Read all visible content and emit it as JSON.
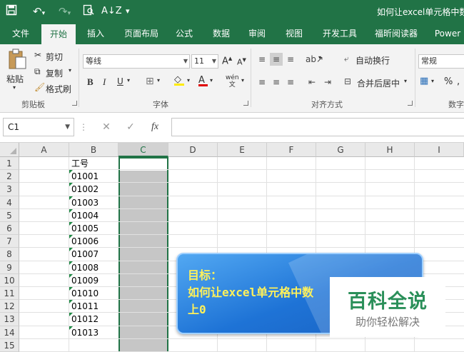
{
  "titlebar": {
    "doc_title": "如何让excel单元格中数字"
  },
  "tabs": [
    {
      "label": "文件"
    },
    {
      "label": "开始"
    },
    {
      "label": "插入"
    },
    {
      "label": "页面布局"
    },
    {
      "label": "公式"
    },
    {
      "label": "数据"
    },
    {
      "label": "审阅"
    },
    {
      "label": "视图"
    },
    {
      "label": "开发工具"
    },
    {
      "label": "福昕阅读器"
    },
    {
      "label": "Power"
    }
  ],
  "ribbon": {
    "clipboard": {
      "paste": "粘贴",
      "cut": "剪切",
      "copy": "复制",
      "format_painter": "格式刷",
      "label": "剪贴板"
    },
    "font": {
      "name": "等线",
      "size": "11",
      "bold": "B",
      "italic": "I",
      "underline": "U",
      "grow": "A",
      "shrink": "A",
      "label": "字体",
      "font_color": "A",
      "phonetic": "wén"
    },
    "alignment": {
      "wrap": "自动换行",
      "merge": "合并后居中",
      "label": "对齐方式"
    },
    "number": {
      "format": "常规",
      "percent": "%",
      "label": "数字"
    }
  },
  "formula_bar": {
    "name_box": "C1",
    "fx": "fx"
  },
  "grid": {
    "columns": [
      "A",
      "B",
      "C",
      "D",
      "E",
      "F",
      "G",
      "H",
      "I"
    ],
    "rows": [
      "1",
      "2",
      "3",
      "4",
      "5",
      "6",
      "7",
      "8",
      "9",
      "10",
      "11",
      "12",
      "13",
      "14",
      "15"
    ],
    "b_values": [
      "工号",
      "01001",
      "01002",
      "01003",
      "01004",
      "01005",
      "01006",
      "01007",
      "01008",
      "01009",
      "01010",
      "01011",
      "01012",
      "01013"
    ]
  },
  "callout": {
    "line1": "目标：",
    "line2": "如何让excel单元格中数",
    "line3": "上0"
  },
  "watermark": {
    "title": "百科全说",
    "subtitle": "助你轻松解决"
  },
  "colors": {
    "excel_green": "#217346",
    "callout_blue": "#1e73d6",
    "callout_text": "#fff15a"
  }
}
